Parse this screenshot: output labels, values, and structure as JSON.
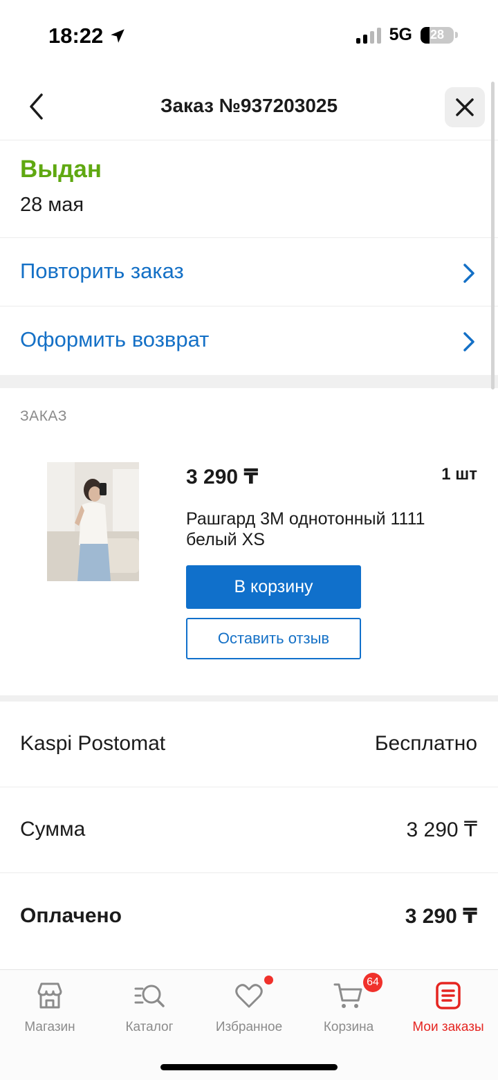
{
  "status_bar": {
    "time": "18:22",
    "network": "5G",
    "battery": "28",
    "battery_level": 0.28
  },
  "header": {
    "title": "Заказ №937203025"
  },
  "order_status": {
    "status": "Выдан",
    "date": "28 мая",
    "status_color": "#5fa811"
  },
  "actions": {
    "repeat": "Повторить заказ",
    "return": "Оформить возврат"
  },
  "order_section": {
    "title": "ЗАКАЗ",
    "item": {
      "price": "3 290 ₸",
      "quantity": "1 шт",
      "name": "Рашгард 3M однотонный 1111 белый XS",
      "add_to_cart": "В корзину",
      "leave_review": "Оставить отзыв"
    }
  },
  "summary": {
    "delivery_label": "Kaspi Postomat",
    "delivery_value": "Бесплатно",
    "sum_label": "Сумма",
    "sum_value": "3 290 ₸",
    "paid_label": "Оплачено",
    "paid_value": "3 290 ₸"
  },
  "bottom_nav": {
    "items": [
      {
        "label": "Магазин",
        "icon": "store-icon"
      },
      {
        "label": "Каталог",
        "icon": "catalog-search-icon"
      },
      {
        "label": "Избранное",
        "icon": "heart-icon"
      },
      {
        "label": "Корзина",
        "icon": "cart-icon",
        "badge": "64"
      },
      {
        "label": "Мои заказы",
        "icon": "orders-icon",
        "active": true
      }
    ]
  },
  "colors": {
    "accent_blue": "#1070cb",
    "link_blue": "#1470c6",
    "active_red": "#e52521",
    "status_green": "#5fa811"
  }
}
